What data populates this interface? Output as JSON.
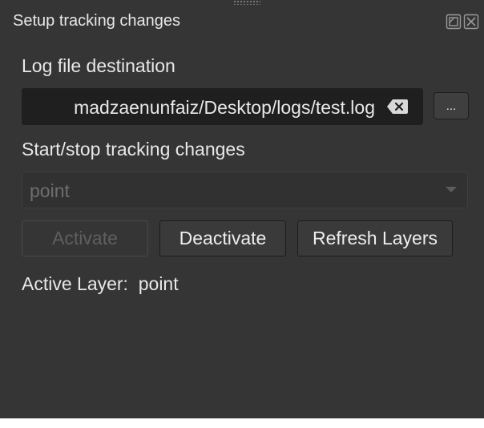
{
  "dock": {
    "title": "Setup tracking changes",
    "float_icon": "float-dock-icon",
    "close_icon": "close-icon"
  },
  "log_section": {
    "label": "Log file destination",
    "path_value": "madzaenunfaiz/Desktop/logs/test.log",
    "browse_label": "..."
  },
  "tracking_section": {
    "label": "Start/stop tracking changes",
    "layer_selected": "point",
    "buttons": {
      "activate": "Activate",
      "deactivate": "Deactivate",
      "refresh": "Refresh Layers"
    }
  },
  "status": {
    "active_layer_label": "Active Layer:",
    "active_layer_value": "point"
  },
  "colors": {
    "panel_bg": "#353535",
    "field_bg": "#1f1f1f",
    "text": "#e8e8e8",
    "disabled_text": "#5f5f5f"
  }
}
